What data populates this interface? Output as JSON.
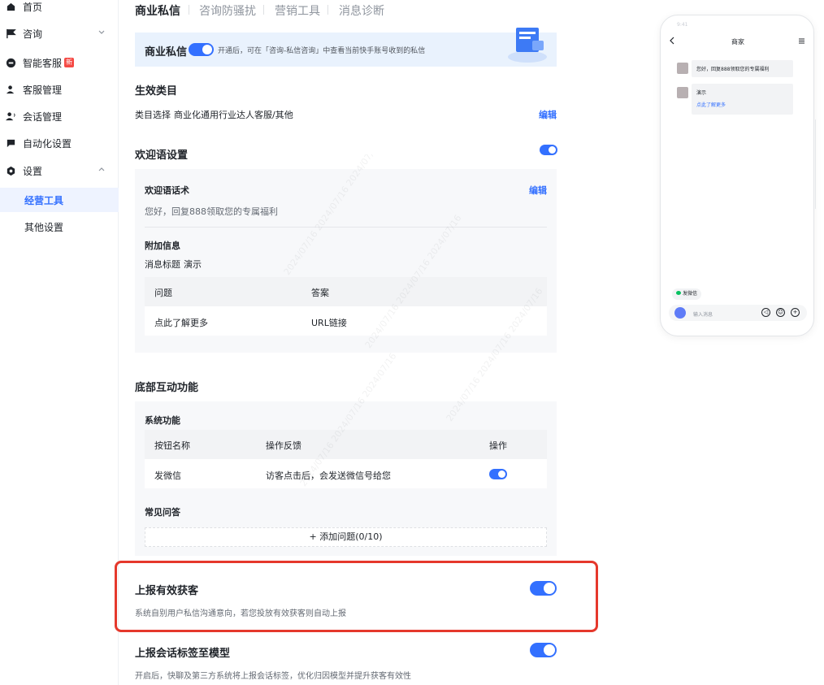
{
  "sidebar": {
    "items": [
      {
        "label": "首页",
        "icon": "home-icon"
      },
      {
        "label": "咨询",
        "icon": "flag-icon"
      },
      {
        "label": "智能客服",
        "icon": "robot-icon",
        "badge": "新"
      },
      {
        "label": "客服管理",
        "icon": "user-icon"
      },
      {
        "label": "会话管理",
        "icon": "user-chat-icon"
      },
      {
        "label": "自动化设置",
        "icon": "message-icon"
      },
      {
        "label": "设置",
        "icon": "settings-icon"
      }
    ],
    "sub_items": [
      {
        "label": "经营工具",
        "active": true
      },
      {
        "label": "其他设置",
        "active": false
      }
    ]
  },
  "tabs": [
    "商业私信",
    "咨询防骚扰",
    "营销工具",
    "消息诊断"
  ],
  "banner": {
    "title": "商业私信",
    "desc": "开通后，可在「咨询-私信咨询」中查看当前快手账号收到的私信"
  },
  "effective_category": {
    "title": "生效类目",
    "label": "类目选择",
    "value": "商业化通用行业达人客服/其他",
    "edit": "编辑"
  },
  "welcome": {
    "title": "欢迎语设置",
    "script_title": "欢迎语话术",
    "script_edit": "编辑",
    "script_text": "您好，回复888领取您的专属福利",
    "extra_title": "附加信息",
    "msg_title_label": "消息标题",
    "msg_title_value": "演示",
    "table_headers": [
      "问题",
      "答案"
    ],
    "table_rows": [
      [
        "点此了解更多",
        "URL链接"
      ]
    ]
  },
  "bottom": {
    "title": "底部互动功能",
    "system_title": "系统功能",
    "headers": [
      "按钮名称",
      "操作反馈",
      "操作"
    ],
    "rows": [
      {
        "name": "发微信",
        "feedback": "访客点击后，会发送微信号给您"
      }
    ],
    "faq_title": "常见问答",
    "add_faq": "+ 添加问题(0/10)"
  },
  "report_leads": {
    "title": "上报有效获客",
    "desc": "系统自别用户私信沟通意向，若您投放有效获客则自动上报"
  },
  "report_tags": {
    "title": "上报会话标签至模型",
    "desc": "开启后，快聊及第三方系统将上报会话标签，优化归因模型并提升获客有效性"
  },
  "phone": {
    "status": "9:41",
    "title": "商家",
    "msg1": "您好，回复888领取您的专属福利",
    "msg2_title": "演示",
    "msg2_link": "点此了解更多",
    "chip": "发微信",
    "input_placeholder": "输入消息"
  },
  "watermark_text": "2024/07/16 2024/07/16 2024/07/16",
  "colors": {
    "accent": "#3370ff",
    "highlight": "#e5382c",
    "wechat": "#07c160"
  }
}
